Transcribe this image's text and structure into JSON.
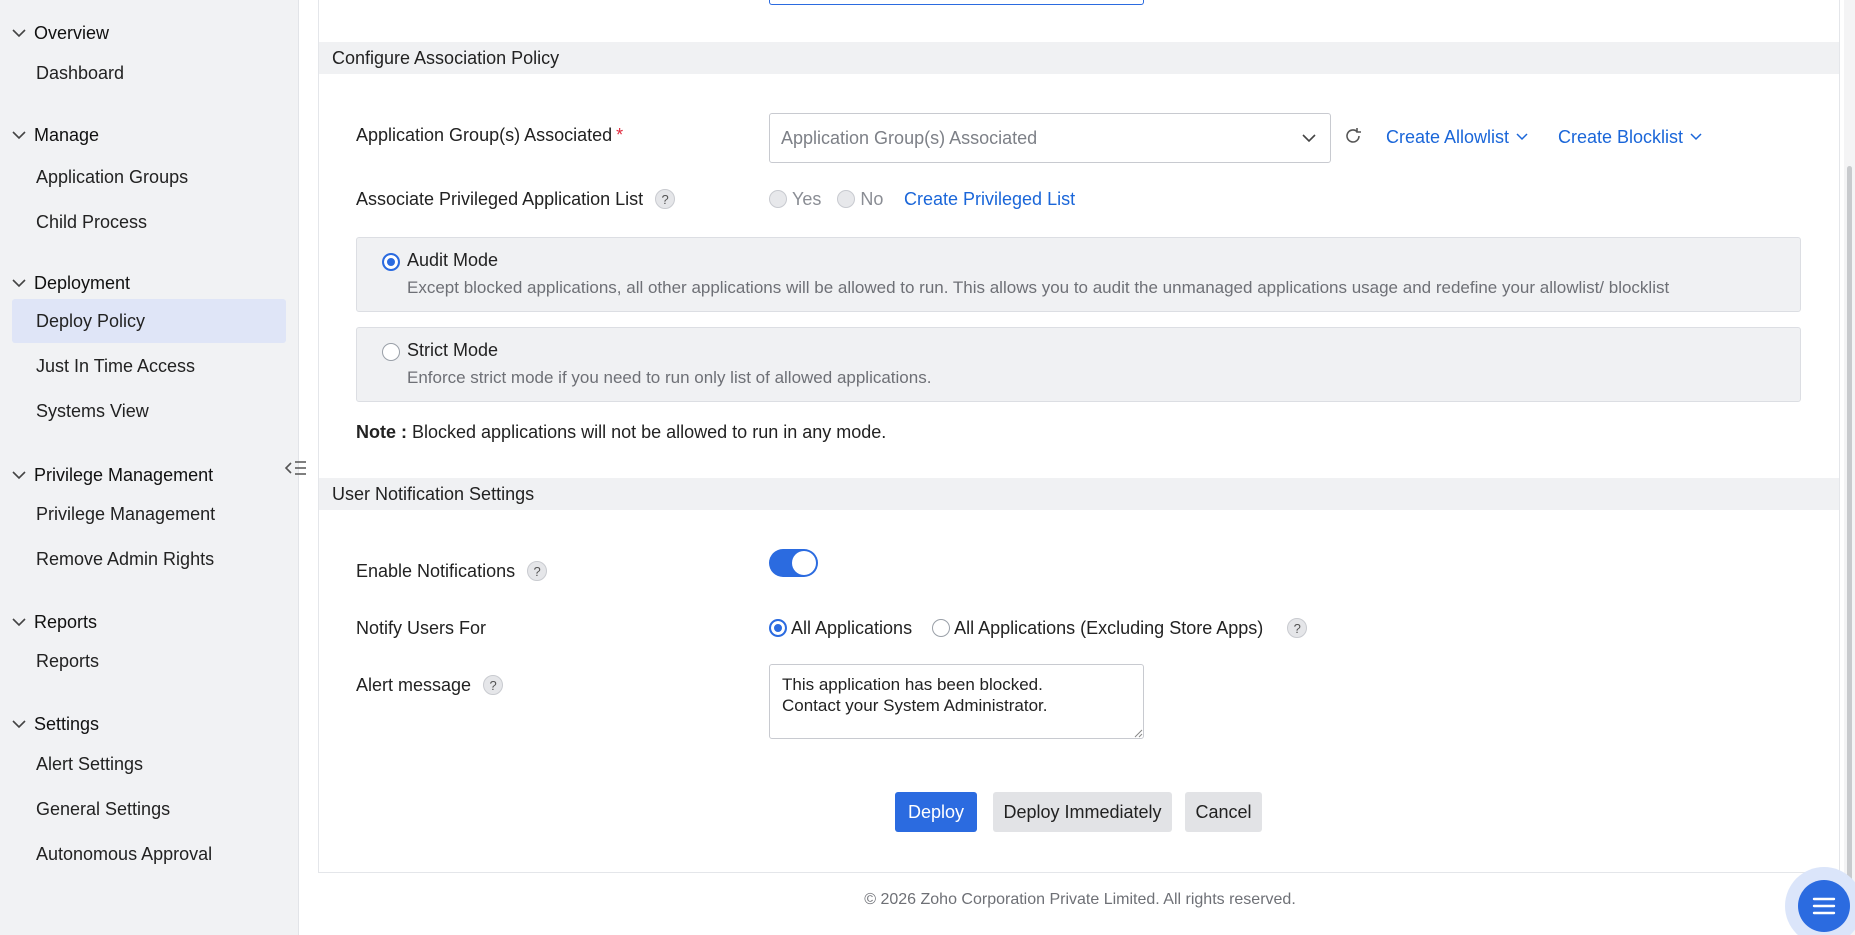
{
  "sidebar": {
    "sections": [
      {
        "title": "Overview",
        "items": [
          "Dashboard"
        ]
      },
      {
        "title": "Manage",
        "items": [
          "Application Groups",
          "Child Process"
        ]
      },
      {
        "title": "Deployment",
        "items": [
          "Deploy Policy",
          "Just In Time Access",
          "Systems View"
        ]
      },
      {
        "title": "Privilege Management",
        "items": [
          "Privilege Management",
          "Remove Admin Rights"
        ]
      },
      {
        "title": "Reports",
        "items": [
          "Reports"
        ]
      },
      {
        "title": "Settings",
        "items": [
          "Alert Settings",
          "General Settings",
          "Autonomous Approval"
        ]
      }
    ],
    "active_item": "Deploy Policy"
  },
  "policy": {
    "section_title": "Configure Association Policy",
    "app_group_label": "Application Group(s) Associated",
    "required_mark": "*",
    "app_group_placeholder": "Application Group(s) Associated",
    "create_allowlist": "Create Allowlist",
    "create_blocklist": "Create Blocklist",
    "privileged_label": "Associate Privileged Application List",
    "help": "?",
    "yes": "Yes",
    "no": "No",
    "create_privileged": "Create Privileged List",
    "audit_title": "Audit Mode",
    "audit_desc": "Except blocked applications, all other applications will be allowed to run. This allows you to audit the unmanaged applications usage and redefine your allowlist/ blocklist",
    "strict_title": "Strict Mode",
    "strict_desc": "Enforce strict mode if you need to run only list of allowed applications.",
    "note_label": "Note :",
    "note_text": "Blocked applications will not be allowed to run in any mode.",
    "selected_mode": "Audit Mode"
  },
  "notify": {
    "section_title": "User Notification Settings",
    "enable_label": "Enable Notifications",
    "enable_on": true,
    "notify_label": "Notify Users For",
    "opt_all": "All Applications",
    "opt_excl": "All Applications (Excluding Store Apps)",
    "selected": "All Applications",
    "alert_label": "Alert message",
    "alert_value": "This application has been blocked.\nContact your System Administrator."
  },
  "actions": {
    "deploy": "Deploy",
    "deploy_now": "Deploy Immediately",
    "cancel": "Cancel"
  },
  "footer": "© 2026 Zoho Corporation Private Limited. All rights reserved.",
  "colors": {
    "accent": "#2b6be0",
    "link": "#1a66d9",
    "active_nav": "#dfe5f7"
  }
}
